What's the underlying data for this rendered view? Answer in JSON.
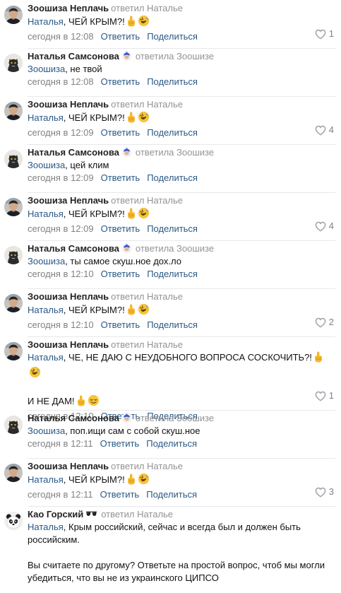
{
  "labels": {
    "reply_action": "Ответить",
    "share_action": "Поделиться"
  },
  "comments": [
    {
      "author": "Зоошиза Неплачь",
      "badge": false,
      "reply_info": "ответил Наталье",
      "addressee": "Наталья",
      "text": ", ЧЕЙ КРЫМ?!",
      "emojis": [
        "middle-finger-icon",
        "rofl-icon"
      ],
      "time": "сегодня в 12:08",
      "likes": "1",
      "avatar": "man"
    },
    {
      "author": "Наталья Самсонова",
      "badge": true,
      "reply_info": "ответила Зоошизе",
      "addressee": "Зоошиза",
      "text": ", не твой",
      "emojis": [],
      "time": "сегодня в 12:08",
      "likes": "",
      "avatar": "cat"
    },
    {
      "author": "Зоошиза Неплачь",
      "badge": false,
      "reply_info": "ответил Наталье",
      "addressee": "Наталья",
      "text": ", ЧЕЙ КРЫМ?!",
      "emojis": [
        "middle-finger-icon",
        "rofl-icon"
      ],
      "time": "сегодня в 12:09",
      "likes": "4",
      "avatar": "man"
    },
    {
      "author": "Наталья Самсонова",
      "badge": true,
      "reply_info": "ответила Зоошизе",
      "addressee": "Зоошиза",
      "text": ", цей клим",
      "emojis": [],
      "time": "сегодня в 12:09",
      "likes": "",
      "avatar": "cat"
    },
    {
      "author": "Зоошиза Неплачь",
      "badge": false,
      "reply_info": "ответил Наталье",
      "addressee": "Наталья",
      "text": ", ЧЕЙ КРЫМ?!",
      "emojis": [
        "middle-finger-icon",
        "rofl-icon"
      ],
      "time": "сегодня в 12:09",
      "likes": "4",
      "avatar": "man"
    },
    {
      "author": "Наталья Самсонова",
      "badge": true,
      "reply_info": "ответила Зоошизе",
      "addressee": "Зоошиза",
      "text": ", ты самое скуш.ное дох.ло",
      "emojis": [],
      "time": "сегодня в 12:10",
      "likes": "",
      "avatar": "cat"
    },
    {
      "author": "Зоошиза Неплачь",
      "badge": false,
      "reply_info": "ответил Наталье",
      "addressee": "Наталья",
      "text": ", ЧЕЙ КРЫМ?!",
      "emojis": [
        "middle-finger-icon",
        "rofl-icon"
      ],
      "time": "сегодня в 12:10",
      "likes": "2",
      "avatar": "man"
    },
    {
      "author": "Зоошиза Неплачь",
      "badge": false,
      "reply_info": "ответил Наталье",
      "addressee": "Наталья",
      "text": ", ЧЕ, НЕ ДАЮ С НЕУДОБНОГО ВОПРОСА СОСКОЧИТЬ?!",
      "emojis": [
        "middle-finger-icon",
        "rofl-icon"
      ],
      "extra_text": "И НЕ ДАМ!",
      "extra_emojis": [
        "middle-finger-icon",
        "relieved-icon"
      ],
      "time": "сегодня в 12:10",
      "likes": "1",
      "avatar": "man"
    },
    {
      "author": "Наталья Самсонова",
      "badge": true,
      "reply_info": "ответила Зоошизе",
      "addressee": "Зоошиза",
      "text": ", поп.ищи сам с собой скуш.ное",
      "emojis": [],
      "time": "сегодня в 12:11",
      "likes": "",
      "avatar": "cat"
    },
    {
      "author": "Зоошиза Неплачь",
      "badge": false,
      "reply_info": "ответил Наталье",
      "addressee": "Наталья",
      "text": ", ЧЕЙ КРЫМ?!",
      "emojis": [
        "middle-finger-icon",
        "rofl-icon"
      ],
      "time": "сегодня в 12:11",
      "likes": "3",
      "avatar": "man"
    },
    {
      "author": "Као Горский",
      "badge": false,
      "sunglasses": true,
      "reply_info": "ответил Наталье",
      "addressee": "Наталья",
      "text": ", Крым российский, сейчас и всегда был и должен быть российским.",
      "emojis": [],
      "extra_text": "Вы считаете по другому? Ответьте на простой вопрос, чтоб мы могли убедиться, что вы не из украинского ЦИПСО",
      "extra_emojis": [],
      "time": "",
      "likes": "",
      "avatar": "panda"
    }
  ]
}
